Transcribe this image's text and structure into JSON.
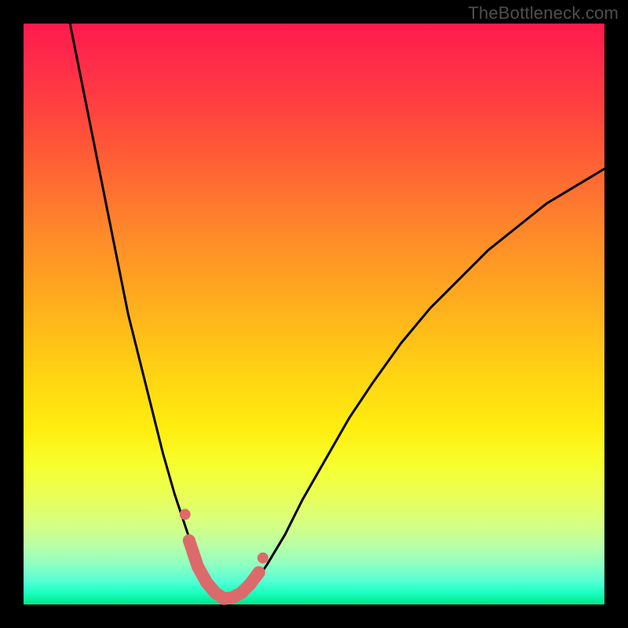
{
  "watermark": "TheBottleneck.com",
  "colors": {
    "frame_background": "#000000",
    "curve_stroke": "#000000",
    "marker_stroke": "#dd6a6a",
    "marker_fill": "#dd6a6a"
  },
  "chart_data": {
    "type": "line",
    "title": "",
    "xlabel": "",
    "ylabel": "",
    "xlim": [
      0,
      100
    ],
    "ylim": [
      0,
      100
    ],
    "grid": false,
    "legend": false,
    "series": [
      {
        "name": "bottleneck-curve",
        "x": [
          8,
          10,
          12,
          14,
          16,
          18,
          20,
          22,
          24,
          26,
          27,
          28,
          29,
          30,
          31,
          32,
          33,
          34,
          35,
          36,
          38,
          40,
          42,
          45,
          48,
          52,
          56,
          60,
          65,
          70,
          75,
          80,
          85,
          90,
          95,
          100
        ],
        "y": [
          100,
          90,
          80,
          70,
          60,
          50,
          42,
          34,
          26,
          19,
          16,
          13,
          10,
          7,
          5,
          3,
          2,
          1.2,
          1,
          1.2,
          2,
          4,
          7,
          12,
          18,
          25,
          32,
          38,
          45,
          51,
          56,
          61,
          65,
          69,
          72,
          75
        ]
      }
    ],
    "markers": {
      "name": "highlight-dots",
      "x": [
        28.5,
        30,
        31.5,
        33,
        34.5,
        36,
        37.5,
        39,
        40.5
      ],
      "y": [
        11,
        6.5,
        3.8,
        2,
        1,
        1.2,
        2,
        3.5,
        5.5
      ]
    },
    "marker_endpoints": {
      "x": [
        27.8,
        41.2
      ],
      "y": [
        15.5,
        8
      ]
    }
  }
}
